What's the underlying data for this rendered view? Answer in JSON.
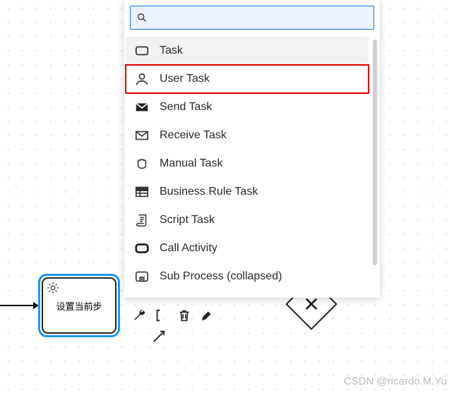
{
  "node": {
    "label": "设置当前步"
  },
  "search": {
    "placeholder": ""
  },
  "menu": {
    "items": [
      {
        "label": "Task"
      },
      {
        "label": "User Task"
      },
      {
        "label": "Send Task"
      },
      {
        "label": "Receive Task"
      },
      {
        "label": "Manual Task"
      },
      {
        "label": "Business Rule Task"
      },
      {
        "label": "Script Task"
      },
      {
        "label": "Call Activity"
      },
      {
        "label": "Sub Process (collapsed)"
      }
    ]
  },
  "watermark": "CSDN @ricardo.M.Yu"
}
